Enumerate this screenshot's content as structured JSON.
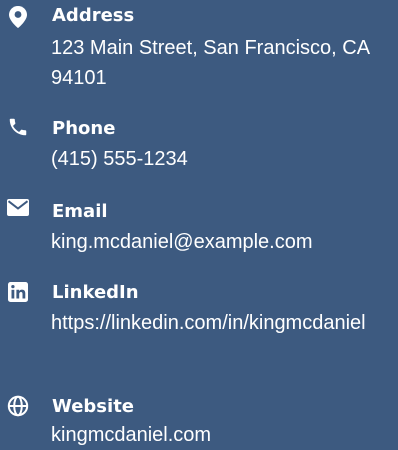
{
  "contact": {
    "address": {
      "label": "Address",
      "value": "123 Main Street, San Francisco, CA 94101",
      "icon": "map-pin-icon"
    },
    "phone": {
      "label": "Phone",
      "value": "(415) 555-1234",
      "icon": "phone-icon"
    },
    "email": {
      "label": "Email",
      "value": "king.mcdaniel@example.com",
      "icon": "envelope-icon"
    },
    "linkedin": {
      "label": "LinkedIn",
      "value": "https://linkedin.com/in/kingmcdaniel",
      "icon": "linkedin-icon"
    },
    "website": {
      "label": "Website",
      "value": "kingmcdaniel.com",
      "icon": "globe-icon"
    }
  },
  "colors": {
    "background": "#3d5a80",
    "text": "#ffffff"
  }
}
